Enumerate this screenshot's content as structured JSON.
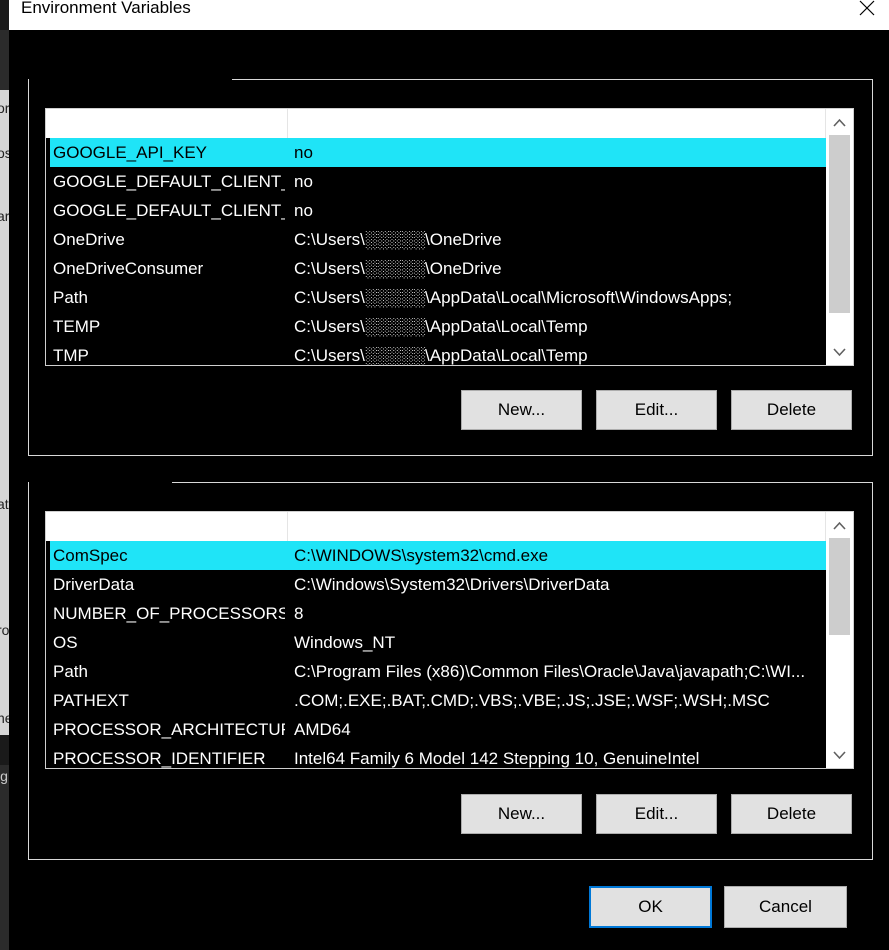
{
  "window": {
    "title": "Environment Variables"
  },
  "user_vars": {
    "rows": [
      {
        "name": "GOOGLE_API_KEY",
        "value": "no",
        "selected": true
      },
      {
        "name": "GOOGLE_DEFAULT_CLIENT_ID",
        "value": "no"
      },
      {
        "name": "GOOGLE_DEFAULT_CLIENT_...",
        "value": "no"
      },
      {
        "name": "OneDrive",
        "value": "C:\\Users\\░░░░░\\OneDrive"
      },
      {
        "name": "OneDriveConsumer",
        "value": "C:\\Users\\░░░░░\\OneDrive"
      },
      {
        "name": "Path",
        "value": "C:\\Users\\░░░░░\\AppData\\Local\\Microsoft\\WindowsApps;"
      },
      {
        "name": "TEMP",
        "value": "C:\\Users\\░░░░░\\AppData\\Local\\Temp"
      },
      {
        "name": "TMP",
        "value": "C:\\Users\\░░░░░\\AppData\\Local\\Temp"
      }
    ],
    "buttons": {
      "new": "New...",
      "edit": "Edit...",
      "delete": "Delete"
    }
  },
  "system_vars": {
    "rows": [
      {
        "name": "ComSpec",
        "value": "C:\\WINDOWS\\system32\\cmd.exe",
        "selected": true
      },
      {
        "name": "DriverData",
        "value": "C:\\Windows\\System32\\Drivers\\DriverData"
      },
      {
        "name": "NUMBER_OF_PROCESSORS",
        "value": "8"
      },
      {
        "name": "OS",
        "value": "Windows_NT"
      },
      {
        "name": "Path",
        "value": "C:\\Program Files (x86)\\Common Files\\Oracle\\Java\\javapath;C:\\WI..."
      },
      {
        "name": "PATHEXT",
        "value": ".COM;.EXE;.BAT;.CMD;.VBS;.VBE;.JS;.JSE;.WSF;.WSH;.MSC"
      },
      {
        "name": "PROCESSOR_ARCHITECTURE",
        "value": "AMD64"
      },
      {
        "name": "PROCESSOR_IDENTIFIER",
        "value": "Intel64 Family 6 Model 142 Stepping 10, GenuineIntel"
      }
    ],
    "buttons": {
      "new": "New...",
      "edit": "Edit...",
      "delete": "Delete"
    }
  },
  "footer": {
    "ok": "OK",
    "cancel": "Cancel"
  },
  "background_window": {
    "glyphs": [
      "or",
      "os",
      "ar",
      "at",
      "ro",
      "ne",
      "ig"
    ]
  },
  "colors": {
    "selection": "#1fe4f7",
    "default_button_border": "#0078d7"
  }
}
